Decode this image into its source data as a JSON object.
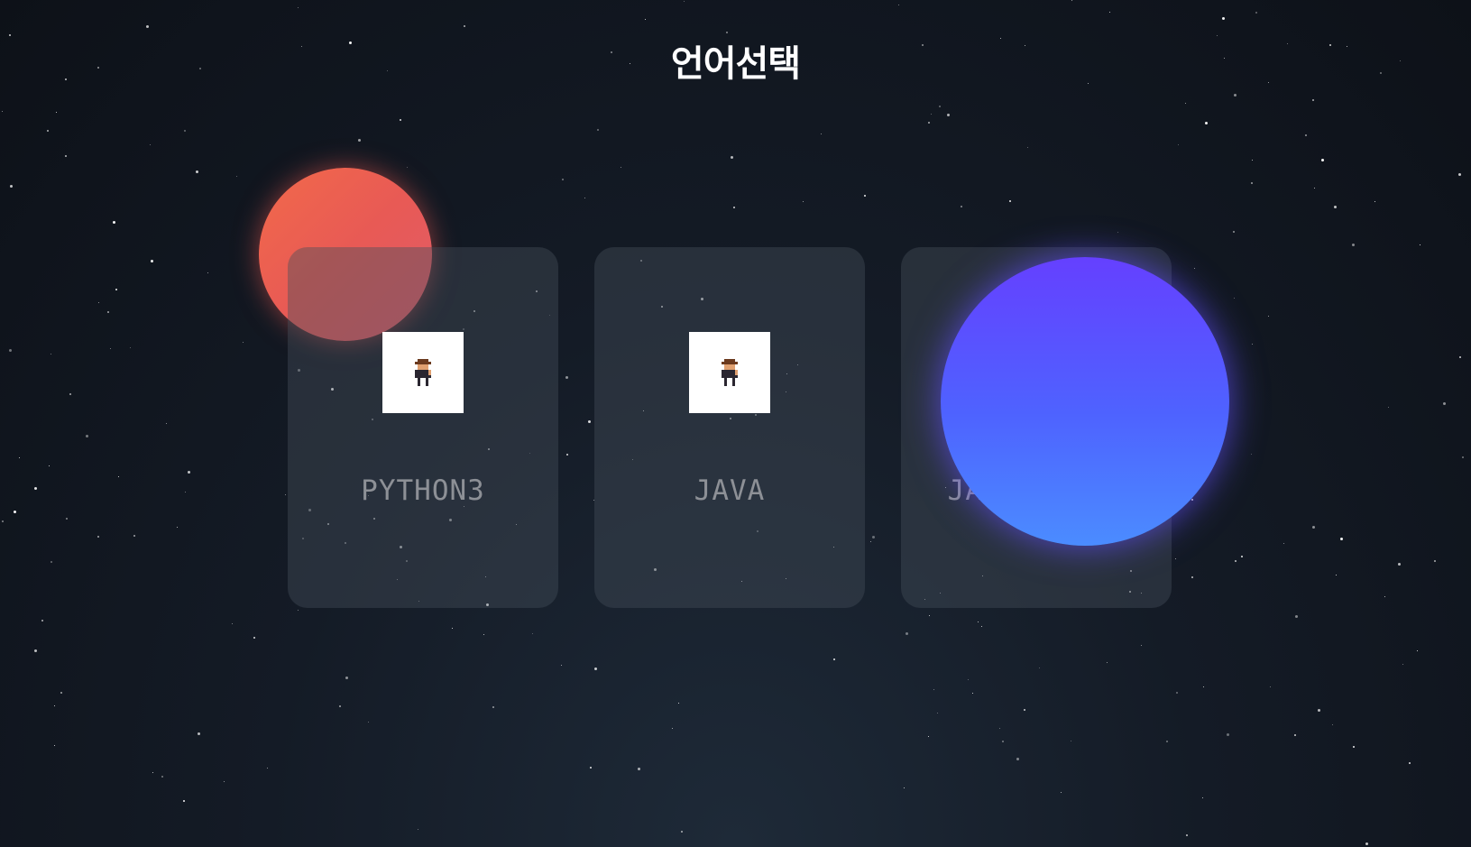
{
  "header": {
    "title": "언어선택"
  },
  "languages": [
    {
      "label": "PYTHON3",
      "avatar_icon": "pixel-character-icon"
    },
    {
      "label": "JAVA",
      "avatar_icon": "pixel-character-icon"
    },
    {
      "label": "JAVASCRIPT",
      "avatar_icon": "pixel-character-icon"
    }
  ],
  "colors": {
    "background": "#121822",
    "card": "#3a414b",
    "red_orb": "#ec5f55",
    "blue_orb": "#5a55ff",
    "label": "#8d9096"
  }
}
